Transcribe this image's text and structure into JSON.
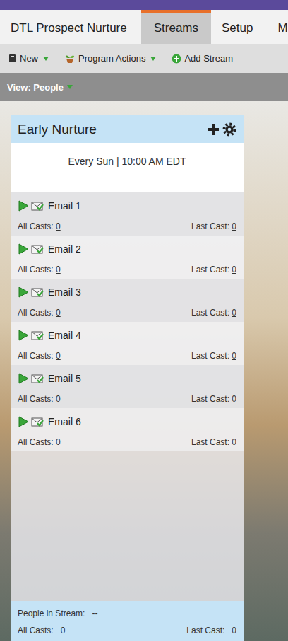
{
  "program_tabs": [
    {
      "label": "DTL Prospect Nurture",
      "selected": false
    },
    {
      "label": "Streams",
      "selected": true
    },
    {
      "label": "Setup",
      "selected": false
    },
    {
      "label": "M",
      "selected": false
    }
  ],
  "toolbar": [
    {
      "label": "New",
      "icon": "book",
      "dropdown": true
    },
    {
      "label": "Program Actions",
      "icon": "plant",
      "dropdown": true
    },
    {
      "label": "Add Stream",
      "icon": "add",
      "dropdown": false
    }
  ],
  "view": {
    "label": "View: People",
    "dropdown": true
  },
  "stream": {
    "title": "Early Nurture",
    "schedule": "Every Sun | 10:00 AM EDT",
    "emails": [
      {
        "name": "Email 1",
        "all_casts_label": "All Casts:",
        "all_casts": "0",
        "last_cast_label": "Last Cast:",
        "last_cast": "0"
      },
      {
        "name": "Email 2",
        "all_casts_label": "All Casts:",
        "all_casts": "0",
        "last_cast_label": "Last Cast:",
        "last_cast": "0"
      },
      {
        "name": "Email 3",
        "all_casts_label": "All Casts:",
        "all_casts": "0",
        "last_cast_label": "Last Cast:",
        "last_cast": "0"
      },
      {
        "name": "Email 4",
        "all_casts_label": "All Casts:",
        "all_casts": "0",
        "last_cast_label": "Last Cast:",
        "last_cast": "0"
      },
      {
        "name": "Email 5",
        "all_casts_label": "All Casts:",
        "all_casts": "0",
        "last_cast_label": "Last Cast:",
        "last_cast": "0"
      },
      {
        "name": "Email 6",
        "all_casts_label": "All Casts:",
        "all_casts": "0",
        "last_cast_label": "Last Cast:",
        "last_cast": "0"
      }
    ],
    "footer": {
      "people_label": "People in Stream:",
      "people": "--",
      "all_casts_label": "All Casts:",
      "all_casts": "0",
      "last_cast_label": "Last Cast:",
      "last_cast": "0"
    }
  }
}
